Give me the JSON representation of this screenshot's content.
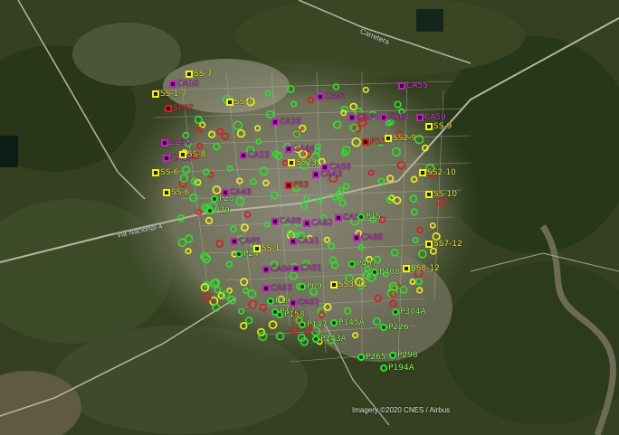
{
  "map": {
    "credit": "Imagery ©2020 CNES / Airbus",
    "road_labels": [
      "Via Nacional 4",
      "Carretera"
    ],
    "marker_colors": {
      "green": "#30e030",
      "yellow": "#f0f020",
      "purple": "#c020c0",
      "red": "#d02020"
    },
    "markers": [
      {
        "label": "SS-7",
        "cat": "yellow"
      },
      {
        "label": "CA10",
        "cat": "purple"
      },
      {
        "label": "SS-1-7",
        "cat": "yellow"
      },
      {
        "label": "SP07",
        "cat": "red"
      },
      {
        "label": "CA29",
        "cat": "purple"
      },
      {
        "label": "SS-7",
        "cat": "yellow"
      },
      {
        "label": "CA47",
        "cat": "purple"
      },
      {
        "label": "CA55",
        "cat": "purple"
      },
      {
        "label": "CA59",
        "cat": "purple"
      },
      {
        "label": "CA64",
        "cat": "purple"
      },
      {
        "label": "CA61",
        "cat": "purple"
      },
      {
        "label": "SS-9",
        "cat": "yellow"
      },
      {
        "label": "CA30",
        "cat": "purple"
      },
      {
        "label": "CA18",
        "cat": "purple"
      },
      {
        "label": "SS-8",
        "cat": "yellow"
      },
      {
        "label": "SS-6",
        "cat": "yellow"
      },
      {
        "label": "SS-6",
        "cat": "yellow"
      },
      {
        "label": "SS2-10",
        "cat": "yellow"
      },
      {
        "label": "SS-10",
        "cat": "yellow"
      },
      {
        "label": "P28",
        "cat": "green"
      },
      {
        "label": "P29",
        "cat": "green"
      },
      {
        "label": "CA46",
        "cat": "purple"
      },
      {
        "label": "CA08",
        "cat": "purple"
      },
      {
        "label": "CA62",
        "cat": "purple"
      },
      {
        "label": "CA06",
        "cat": "purple"
      },
      {
        "label": "CA05",
        "cat": "purple"
      },
      {
        "label": "CA61",
        "cat": "purple"
      },
      {
        "label": "SS7-12",
        "cat": "yellow"
      },
      {
        "label": "P24",
        "cat": "green"
      },
      {
        "label": "SS-1",
        "cat": "yellow"
      },
      {
        "label": "CA04",
        "cat": "purple"
      },
      {
        "label": "CA01",
        "cat": "purple"
      },
      {
        "label": "P407",
        "cat": "green"
      },
      {
        "label": "P408",
        "cat": "green"
      },
      {
        "label": "SS8-12",
        "cat": "yellow"
      },
      {
        "label": "SS3-11",
        "cat": "yellow"
      },
      {
        "label": "CA03",
        "cat": "purple"
      },
      {
        "label": "P09",
        "cat": "green"
      },
      {
        "label": "CA02",
        "cat": "purple"
      },
      {
        "label": "P19",
        "cat": "green"
      },
      {
        "label": "P17",
        "cat": "green"
      },
      {
        "label": "P304A",
        "cat": "green"
      },
      {
        "label": "P158",
        "cat": "green"
      },
      {
        "label": "P147",
        "cat": "green"
      },
      {
        "label": "P145A",
        "cat": "green"
      },
      {
        "label": "P143A",
        "cat": "green"
      },
      {
        "label": "P226",
        "cat": "green"
      },
      {
        "label": "P265",
        "cat": "green"
      },
      {
        "label": "P298",
        "cat": "green"
      },
      {
        "label": "P194A",
        "cat": "green"
      },
      {
        "label": "CA22",
        "cat": "purple"
      },
      {
        "label": "CA44",
        "cat": "purple"
      },
      {
        "label": "SS23",
        "cat": "yellow"
      },
      {
        "label": "SS2-9",
        "cat": "yellow"
      },
      {
        "label": "CA43",
        "cat": "purple"
      },
      {
        "label": "CA66",
        "cat": "purple"
      },
      {
        "label": "CA69",
        "cat": "purple"
      },
      {
        "label": "P15",
        "cat": "green"
      },
      {
        "label": "P03",
        "cat": "red"
      },
      {
        "label": "P35",
        "cat": "red"
      }
    ]
  }
}
